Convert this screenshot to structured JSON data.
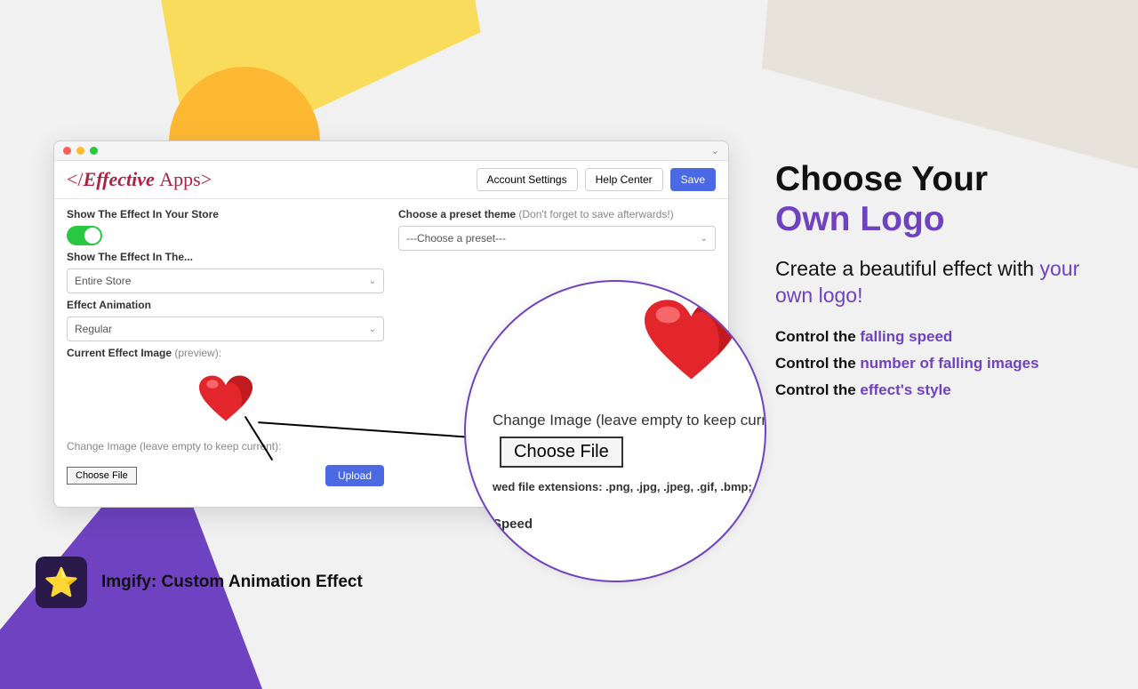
{
  "window": {
    "brand": "</Effective Apps>",
    "topButtons": {
      "account": "Account Settings",
      "help": "Help Center",
      "save": "Save"
    },
    "left": {
      "showEffect": "Show The Effect In Your Store",
      "showIn": "Show The Effect In The...",
      "showInVal": "Entire Store",
      "anim": "Effect Animation",
      "animVal": "Regular",
      "current": "Current Effect Image",
      "currentHint": "(preview):",
      "change": "Change Image (leave empty to keep current):",
      "choose": "Choose File",
      "upload": "Upload"
    },
    "right": {
      "preset": "Choose a preset theme",
      "presetHint": "(Don't forget to save afterwards!)",
      "presetVal": "---Choose a preset---"
    }
  },
  "mag": {
    "change": "Change Image (leave empty to keep current)",
    "choose": "Choose File",
    "ext": "wed file extensions: .png, .jpg, .jpeg, .gif, .bmp;",
    "speed": "Speed"
  },
  "promo": {
    "h1a": "Choose Your",
    "h1b": "Own Logo",
    "sub1": "Create a beautiful effect with ",
    "sub2": "your own logo!",
    "l1a": "Control the ",
    "l1b": "falling speed",
    "l2a": "Control the ",
    "l2b": "number of falling images",
    "l3a": "Control the ",
    "l3b": "effect's style"
  },
  "footer": {
    "name": "Imgify: Custom Animation Effect"
  }
}
